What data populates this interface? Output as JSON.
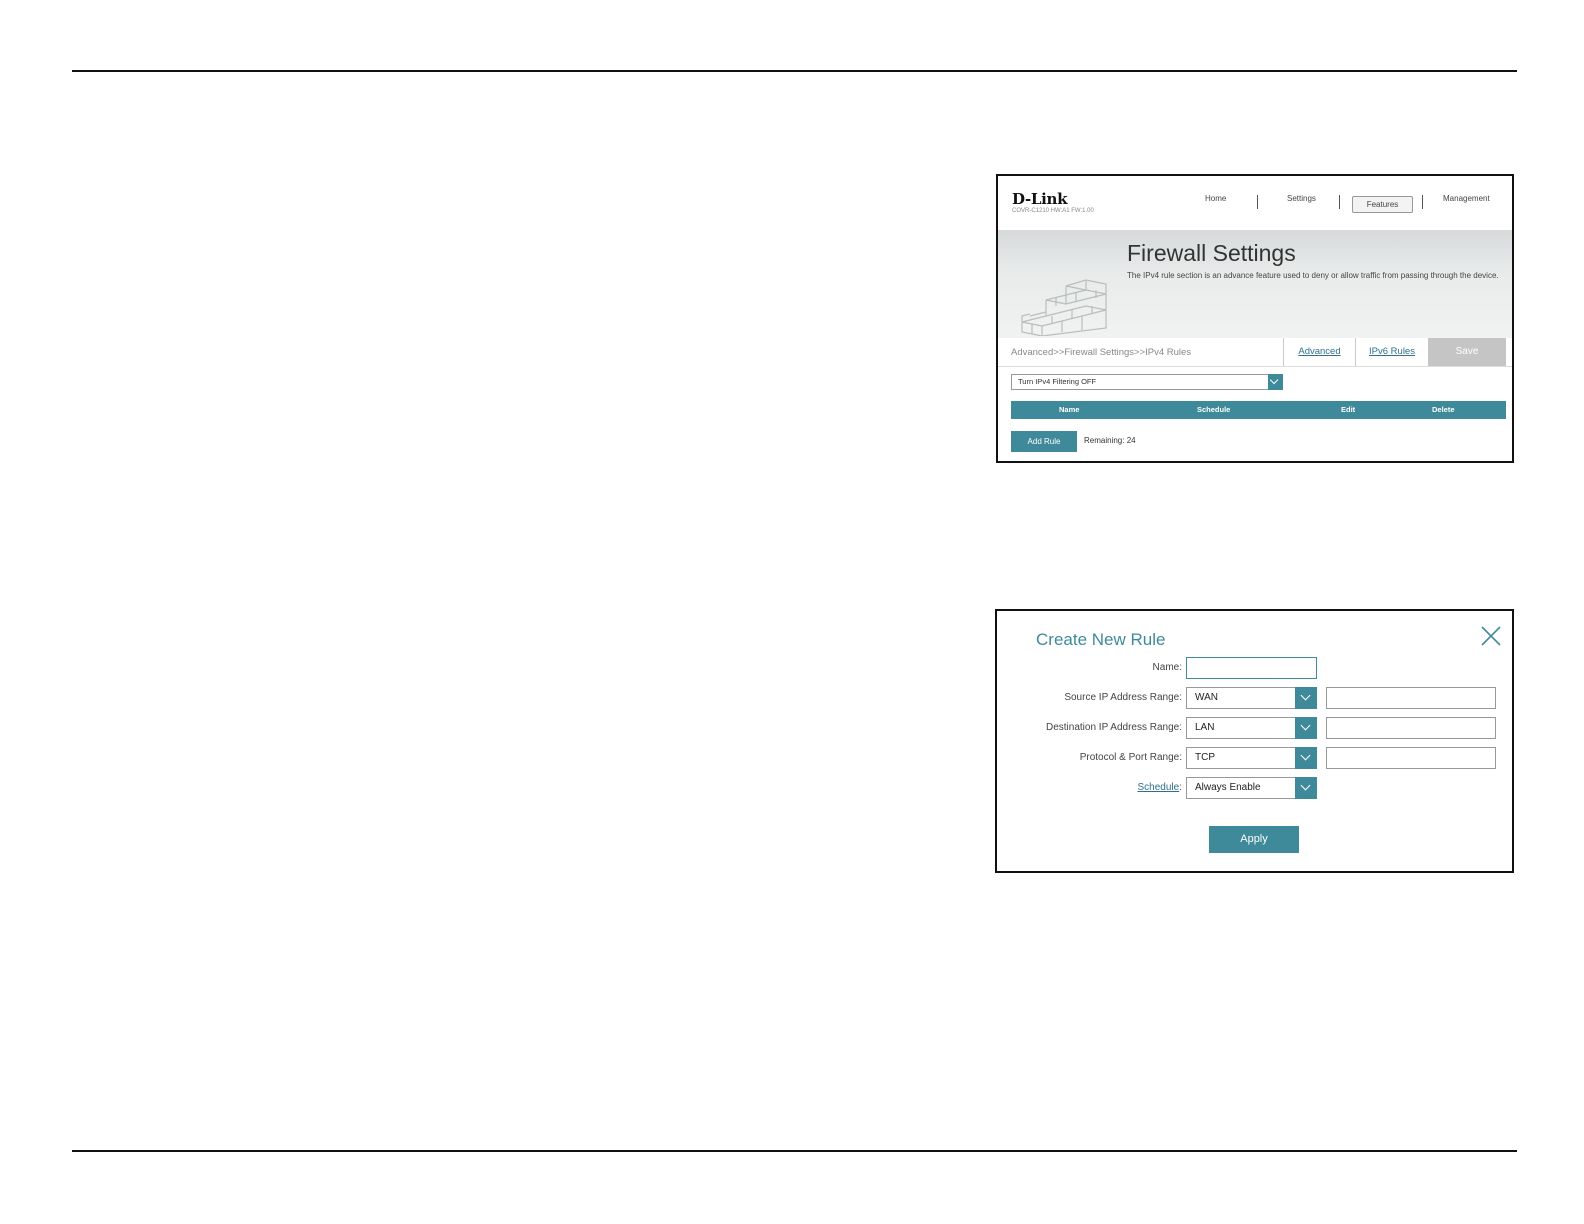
{
  "firewall": {
    "logo": "D-Link",
    "model": "COVR-C1210 HW:A1 FW:1.00",
    "nav": {
      "home": "Home",
      "settings": "Settings",
      "features": "Features",
      "management": "Management"
    },
    "title": "Firewall Settings",
    "description": "The IPv4 rule section is an advance feature used to deny or allow traffic from passing through the device.",
    "breadcrumb": "Advanced>>Firewall Settings>>IPv4 Rules",
    "tabs": {
      "advanced": "Advanced",
      "ipv6": "IPv6 Rules"
    },
    "save": "Save",
    "filter_value": "Turn IPv4 Filtering OFF",
    "table_headers": {
      "name": "Name",
      "schedule": "Schedule",
      "edit": "Edit",
      "delete": "Delete"
    },
    "add_rule": "Add Rule",
    "remaining": "Remaining: 24"
  },
  "create_rule": {
    "title": "Create New Rule",
    "labels": {
      "name": "Name:",
      "source": "Source IP Address Range:",
      "destination": "Destination IP Address Range:",
      "protocol": "Protocol & Port Range:",
      "schedule": "Schedule",
      "schedule_colon": ":"
    },
    "values": {
      "name": "",
      "source": "WAN",
      "destination": "LAN",
      "protocol": "TCP",
      "schedule": "Always Enable",
      "source_range": "",
      "destination_range": "",
      "port_range": ""
    },
    "apply": "Apply"
  },
  "colors": {
    "accent": "#3f8a9a",
    "link": "#2f6f8f",
    "save_disabled": "#c5c5c5"
  }
}
